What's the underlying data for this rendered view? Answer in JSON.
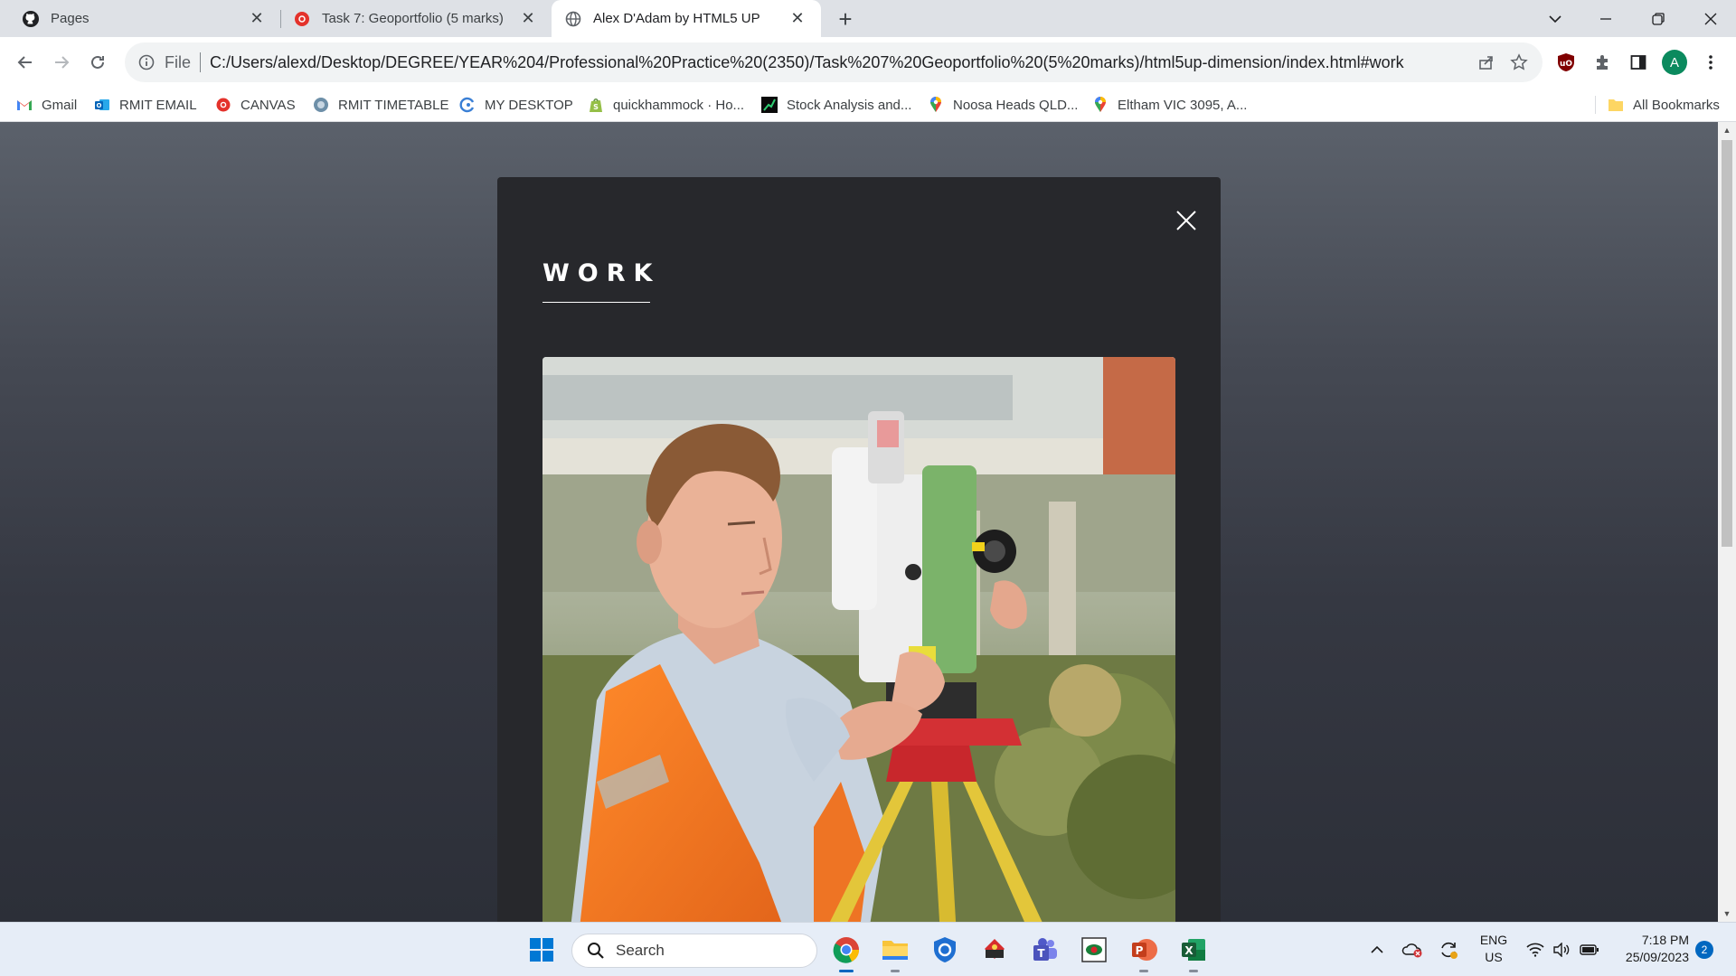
{
  "browser": {
    "tabs": [
      {
        "title": "Pages",
        "icon": "github-icon",
        "active": false
      },
      {
        "title": "Task 7: Geoportfolio (5 marks)",
        "icon": "canvas-icon",
        "active": false
      },
      {
        "title": "Alex D'Adam by HTML5 UP",
        "icon": "globe-icon",
        "active": true
      }
    ],
    "new_tab_label": "+",
    "url_scheme": "File",
    "url": "C:/Users/alexd/Desktop/DEGREE/YEAR%204/Professional%20Practice%20(2350)/Task%207%20Geoportfolio%20(5%20marks)/html5up-dimension/index.html#work",
    "profile_initial": "A",
    "bookmarks": [
      {
        "label": "Gmail",
        "icon": "gmail-icon"
      },
      {
        "label": "RMIT EMAIL",
        "icon": "outlook-icon"
      },
      {
        "label": "CANVAS",
        "icon": "canvas-icon"
      },
      {
        "label": "RMIT TIMETABLE",
        "icon": "timetable-icon"
      },
      {
        "label": "MY DESKTOP",
        "icon": "desktop-icon"
      },
      {
        "label": "quickhammock · Ho...",
        "icon": "shopify-icon"
      },
      {
        "label": "Stock Analysis and...",
        "icon": "stock-icon"
      },
      {
        "label": "Noosa Heads QLD...",
        "icon": "maps-pin-icon"
      },
      {
        "label": "Eltham VIC 3095, A...",
        "icon": "maps-pin-icon"
      }
    ],
    "all_bookmarks_label": "All Bookmarks"
  },
  "page": {
    "section_title": "WORK",
    "photo_description_icon": "surveyor-photo"
  },
  "taskbar": {
    "search_label": "Search",
    "lang_line1": "ENG",
    "lang_line2": "US",
    "time": "7:18 PM",
    "date": "25/09/2023",
    "notification_count": "2"
  },
  "colors": {
    "modal_bg": "#27282c",
    "accent_blue": "#0067c0",
    "chrome_tabstrip": "#dee1e6"
  }
}
